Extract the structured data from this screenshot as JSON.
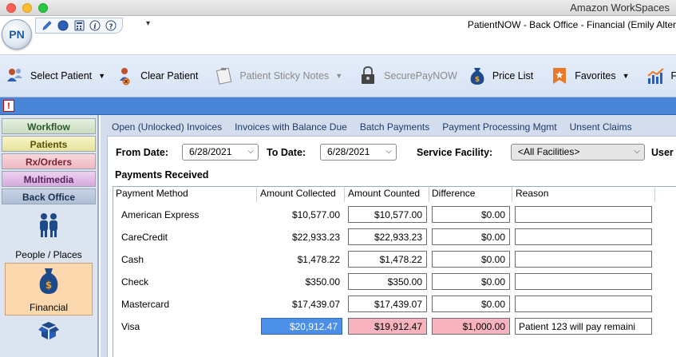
{
  "window": {
    "title": "Amazon WorkSpaces",
    "app_title": "PatientNOW - Back Office - Financial (Emily Alter"
  },
  "logo": {
    "text": "PN"
  },
  "quick_access": {
    "icons": [
      "pen-icon",
      "globe-icon",
      "calculator-icon",
      "info-icon",
      "help-icon"
    ],
    "caret": "▾"
  },
  "toolbar": {
    "select_patient": "Select Patient",
    "clear_patient": "Clear Patient",
    "sticky_notes": "Patient Sticky Notes",
    "securepay": "SecurePayNOW",
    "price_list": "Price List",
    "favorites": "Favorites",
    "reports_partial": "F"
  },
  "left_nav": {
    "tabs": [
      "Workflow",
      "Patients",
      "Rx/Orders",
      "Multimedia",
      "Back Office"
    ],
    "items": [
      "People / Places",
      "Financial"
    ]
  },
  "content_tabs": [
    "Open (Unlocked) Invoices",
    "Invoices with Balance Due",
    "Batch Payments",
    "Payment Processing Mgmt",
    "Unsent Claims"
  ],
  "filters": {
    "from_label": "From Date:",
    "from_value": "6/28/2021",
    "to_label": "To Date:",
    "to_value": "6/28/2021",
    "facility_label": "Service Facility:",
    "facility_value": "<All Facilities>",
    "user_label": "User"
  },
  "payments": {
    "title": "Payments Received",
    "columns": [
      "Payment Method",
      "Amount Collected",
      "Amount Counted",
      "Difference",
      "Reason"
    ],
    "rows": [
      {
        "method": "American Express",
        "collected": "$10,577.00",
        "counted": "$10,577.00",
        "difference": "$0.00",
        "reason": ""
      },
      {
        "method": "CareCredit",
        "collected": "$22,933.23",
        "counted": "$22,933.23",
        "difference": "$0.00",
        "reason": ""
      },
      {
        "method": "Cash",
        "collected": "$1,478.22",
        "counted": "$1,478.22",
        "difference": "$0.00",
        "reason": ""
      },
      {
        "method": "Check",
        "collected": "$350.00",
        "counted": "$350.00",
        "difference": "$0.00",
        "reason": ""
      },
      {
        "method": "Mastercard",
        "collected": "$17,439.07",
        "counted": "$17,439.07",
        "difference": "$0.00",
        "reason": ""
      },
      {
        "method": "Visa",
        "collected": "$20,912.47",
        "counted": "$19,912.47",
        "difference": "$1,000.00",
        "reason": "Patient 123 will pay remaini"
      }
    ]
  },
  "colors": {
    "selected_cell": "#4b8fe6",
    "mismatch_cell": "#f7b4be",
    "toolbar_bg": "#dce7f6",
    "nav_selected": "#fbd8ad"
  }
}
